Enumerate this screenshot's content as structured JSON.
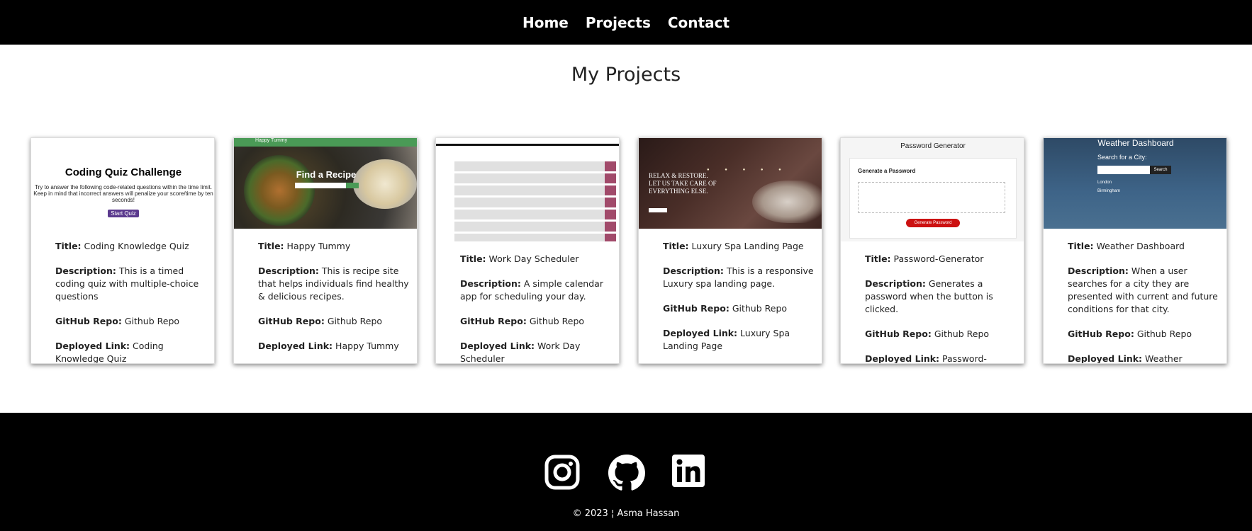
{
  "nav": {
    "links": [
      "Home",
      "Projects",
      "Contact"
    ]
  },
  "page_title": "My Projects",
  "projects": [
    {
      "thumb": {
        "title": "Coding Quiz Challenge",
        "desc": "Try to answer the following code-related questions within the time limit. Keep in mind that incorrect answers will penalize your score/time by ten seconds!",
        "button": "Start Quiz"
      },
      "title_label": "Title:",
      "title": "Coding Knowledge Quiz",
      "desc_label": "Description:",
      "description": "This is a timed coding quiz with multiple-choice questions",
      "repo_label": "GitHub Repo:",
      "repo": "Github Repo",
      "link_label": "Deployed Link:",
      "link": "Coding Knowledge Quiz"
    },
    {
      "thumb": {
        "brand": "Happy Tummy",
        "heading": "Find a Recipe"
      },
      "title_label": "Title:",
      "title": "Happy Tummy",
      "desc_label": "Description:",
      "description": "This is recipe site that helps individuals find healthy & delicious recipes.",
      "repo_label": "GitHub Repo:",
      "repo": "Github Repo",
      "link_label": "Deployed Link:",
      "link": "Happy Tummy"
    },
    {
      "thumb": {},
      "title_label": "Title:",
      "title": "Work Day Scheduler",
      "desc_label": "Description:",
      "description": "A simple calendar app for scheduling your day.",
      "repo_label": "GitHub Repo:",
      "repo": "Github Repo",
      "link_label": "Deployed Link:",
      "link": "Work Day Scheduler"
    },
    {
      "thumb": {
        "heading": "RELAX & RESTORE. LET US TAKE CARE OF EVERYTHING ELSE."
      },
      "title_label": "Title:",
      "title": "Luxury Spa Landing Page",
      "desc_label": "Description:",
      "description": "This is a responsive Luxury spa landing page.",
      "repo_label": "GitHub Repo:",
      "repo": "Github Repo",
      "link_label": "Deployed Link:",
      "link": "Luxury Spa Landing Page"
    },
    {
      "thumb": {
        "title": "Password Generator",
        "subtitle": "Generate a Password",
        "button": "Generate Password"
      },
      "title_label": "Title:",
      "title": "Password-Generator",
      "desc_label": "Description:",
      "description": "Generates a password when the button is clicked.",
      "repo_label": "GitHub Repo:",
      "repo": "Github Repo",
      "link_label": "Deployed Link:",
      "link": "Password-Generator"
    },
    {
      "thumb": {
        "title": "Weather Dashboard",
        "search_label": "Search for a City:",
        "button": "Search",
        "cities": [
          "London",
          "Birmingham"
        ]
      },
      "title_label": "Title:",
      "title": "Weather Dashboard",
      "desc_label": "Description:",
      "description": "When a user searches for a city they are presented with current and future conditions for that city.",
      "repo_label": "GitHub Repo:",
      "repo": "Github Repo",
      "link_label": "Deployed Link:",
      "link": "Weather Dashboard"
    }
  ],
  "footer": {
    "icons": [
      "instagram-icon",
      "github-icon",
      "linkedin-icon"
    ],
    "copyright": "© 2023 ¦ Asma Hassan"
  }
}
